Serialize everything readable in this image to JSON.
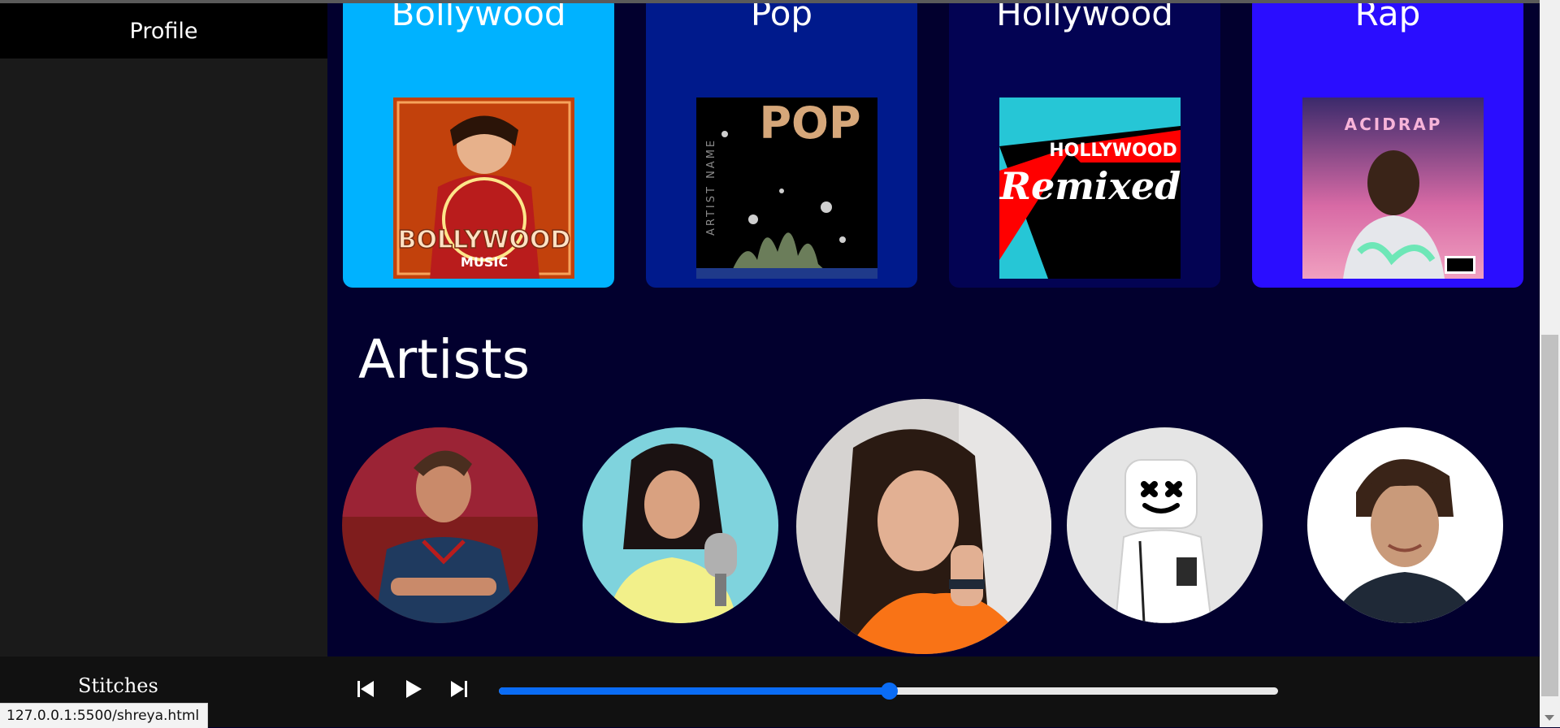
{
  "sidebar": {
    "profile_label": "Profile"
  },
  "genres": [
    {
      "title": "Bollywood",
      "color": "#00b2ff",
      "cover_text": "BOLLYWOOD",
      "cover_sub": "MUSIC",
      "cover_icon": "bollywood-cover"
    },
    {
      "title": "Pop",
      "color": "#001a8c",
      "cover_text": "POP",
      "cover_sub": "ARTIST NAME",
      "cover_icon": "pop-cover"
    },
    {
      "title": "Hollywood",
      "color": "#030353",
      "cover_text": "HOLLYWOOD",
      "cover_sub": "Remixed",
      "cover_icon": "hollywood-cover"
    },
    {
      "title": "Rap",
      "color": "#2a0dff",
      "cover_text": "ACIDRAP",
      "cover_sub": "",
      "cover_icon": "acidrap-cover"
    }
  ],
  "artists_heading": "Artists",
  "artists": [
    {
      "icon": "artist-portrait-1"
    },
    {
      "icon": "artist-portrait-2"
    },
    {
      "icon": "artist-portrait-3"
    },
    {
      "icon": "artist-portrait-4-marshmello"
    },
    {
      "icon": "artist-portrait-5"
    }
  ],
  "player": {
    "track_name": "Stitches",
    "progress": 0.5,
    "prev_icon": "skip-previous-icon",
    "play_icon": "play-icon",
    "next_icon": "skip-next-icon",
    "accent": "#0a6cf5"
  },
  "statusbar": {
    "url": "127.0.0.1:5500/shreya.html"
  }
}
